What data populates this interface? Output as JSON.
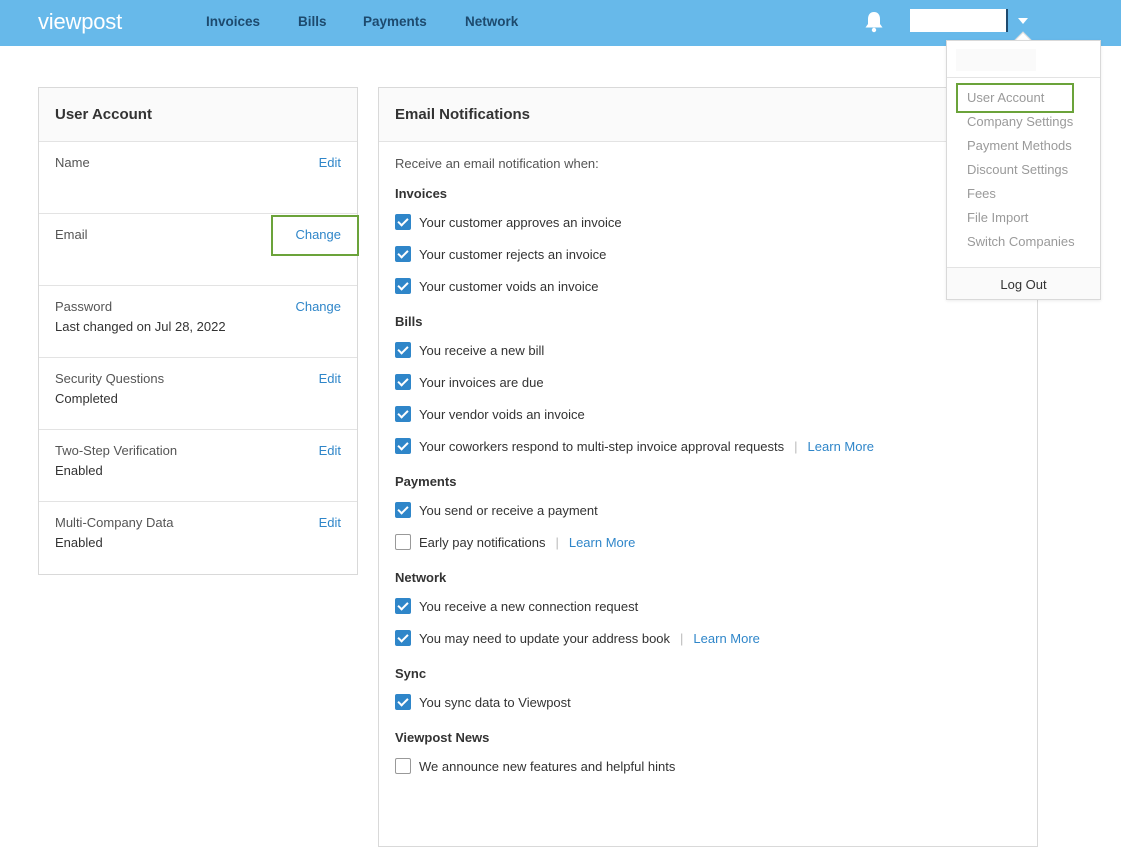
{
  "header": {
    "logo": "viewpost",
    "nav": [
      "Invoices",
      "Bills",
      "Payments",
      "Network"
    ]
  },
  "user_account": {
    "title": "User Account",
    "rows": [
      {
        "label": "Name",
        "value": "",
        "action": "Edit"
      },
      {
        "label": "Email",
        "value": "",
        "action": "Change"
      },
      {
        "label": "Password",
        "value": "Last changed on Jul 28, 2022",
        "action": "Change"
      },
      {
        "label": "Security Questions",
        "value": "Completed",
        "action": "Edit"
      },
      {
        "label": "Two-Step Verification",
        "value": "Enabled",
        "action": "Edit"
      },
      {
        "label": "Multi-Company Data",
        "value": "Enabled",
        "action": "Edit"
      }
    ]
  },
  "email_notifications": {
    "title": "Email Notifications",
    "intro": "Receive an email notification when:",
    "learn_more": "Learn More",
    "sections": [
      {
        "title": "Invoices",
        "items": [
          {
            "text": "Your customer approves an invoice",
            "checked": true
          },
          {
            "text": "Your customer rejects an invoice",
            "checked": true
          },
          {
            "text": "Your customer voids an invoice",
            "checked": true
          }
        ]
      },
      {
        "title": "Bills",
        "items": [
          {
            "text": "You receive a new bill",
            "checked": true
          },
          {
            "text": "Your invoices are due",
            "checked": true
          },
          {
            "text": "Your vendor voids an invoice",
            "checked": true
          },
          {
            "text": "Your coworkers respond to multi-step invoice approval requests",
            "checked": true
          }
        ]
      },
      {
        "title": "Payments",
        "items": [
          {
            "text": "You send or receive a payment",
            "checked": true
          },
          {
            "text": "Early pay notifications",
            "checked": false
          }
        ]
      },
      {
        "title": "Network",
        "items": [
          {
            "text": "You receive a new connection request",
            "checked": true
          },
          {
            "text": "You may need to update your address book",
            "checked": true
          }
        ]
      },
      {
        "title": "Sync",
        "items": [
          {
            "text": "You sync data to Viewpost",
            "checked": true
          }
        ]
      },
      {
        "title": "Viewpost News",
        "items": [
          {
            "text": "We announce new features and helpful hints",
            "checked": false
          }
        ]
      }
    ]
  },
  "user_menu": {
    "items": [
      "User Account",
      "Company Settings",
      "Payment Methods",
      "Discount Settings",
      "Fees",
      "File Import",
      "Switch Companies"
    ],
    "logout": "Log Out"
  },
  "colors": {
    "header": "#67b9ea",
    "link": "#2f86c9",
    "highlight": "#6ba33a"
  }
}
